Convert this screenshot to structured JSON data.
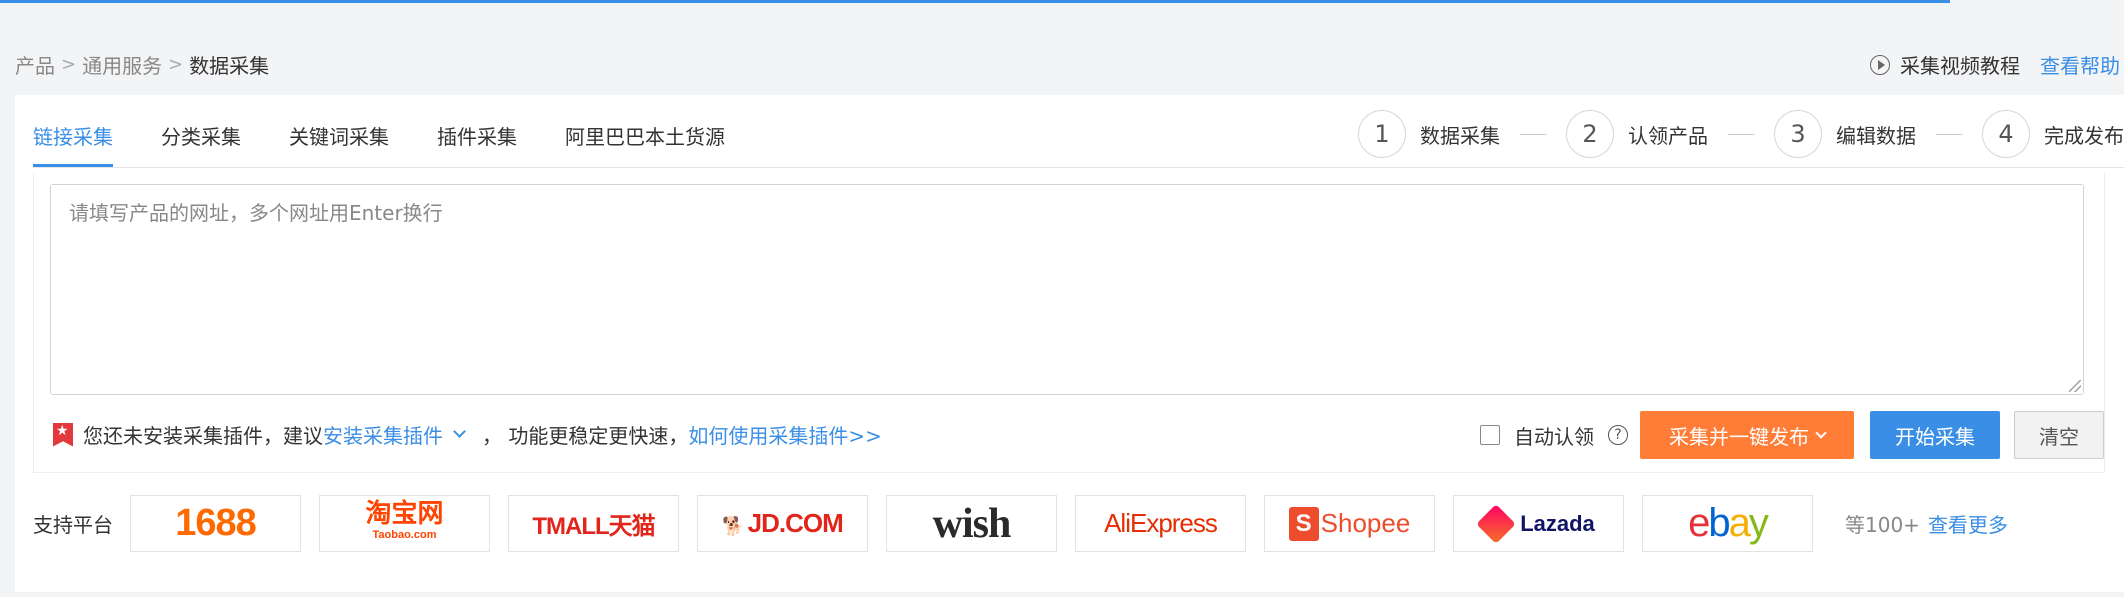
{
  "breadcrumb": {
    "items": [
      "产品",
      "通用服务"
    ],
    "current": "数据采集",
    "separator": ">"
  },
  "help": {
    "tutorial": "采集视频教程",
    "help_link": "查看帮助"
  },
  "tabs": [
    {
      "label": "链接采集",
      "active": true
    },
    {
      "label": "分类采集",
      "active": false
    },
    {
      "label": "关键词采集",
      "active": false
    },
    {
      "label": "插件采集",
      "active": false
    },
    {
      "label": "阿里巴巴本土货源",
      "active": false
    }
  ],
  "steps": [
    {
      "num": "1",
      "label": "数据采集"
    },
    {
      "num": "2",
      "label": "认领产品"
    },
    {
      "num": "3",
      "label": "编辑数据"
    },
    {
      "num": "4",
      "label": "完成发布"
    }
  ],
  "url_input": {
    "placeholder": "请填写产品的网址，多个网址用Enter换行",
    "value": ""
  },
  "notice": {
    "prefix": "您还未安装采集插件，建议",
    "install_link": "安装采集插件",
    "middle": "，  功能更稳定更快速，",
    "howto_link": "如何使用采集插件>>"
  },
  "actions": {
    "auto_claim_label": "自动认领",
    "auto_claim_checked": false,
    "collect_publish": "采集并一键发布",
    "start": "开始采集",
    "clear": "清空"
  },
  "platforms": {
    "label": "支持平台",
    "items": [
      {
        "name": "1688",
        "text": "1688"
      },
      {
        "name": "taobao",
        "text": "淘宝网",
        "sub": "Taobao.com"
      },
      {
        "name": "tmall",
        "text": "TMALL天猫"
      },
      {
        "name": "jd",
        "text": "JD.COM"
      },
      {
        "name": "wish",
        "text": "wish"
      },
      {
        "name": "aliexpress",
        "text": "AliExpress"
      },
      {
        "name": "shopee",
        "text": "Shopee"
      },
      {
        "name": "lazada",
        "text": "Lazada"
      },
      {
        "name": "ebay",
        "text": "ebay"
      }
    ],
    "more_count": "等100+",
    "more_link": "查看更多"
  },
  "colors": {
    "accent": "#3a8ee6",
    "orange": "#ff7d36",
    "warning_icon": "#e4393c"
  }
}
